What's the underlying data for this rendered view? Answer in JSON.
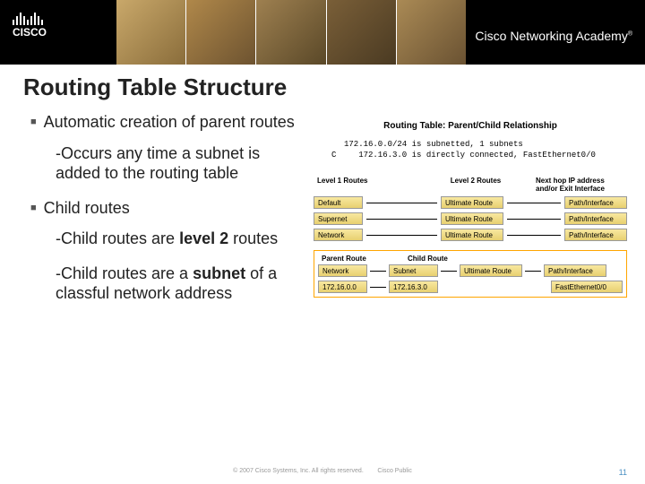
{
  "header": {
    "logo_text": "CISCO",
    "academy": "Cisco Networking Academy",
    "tm": "®"
  },
  "title": "Routing Table Structure",
  "bullets": {
    "b1": "Automatic creation of parent routes",
    "b1_sub": "-Occurs any time a subnet is added to the routing table",
    "b2": "Child routes",
    "b2_sub1_a": "-Child routes are ",
    "b2_sub1_b": "level 2",
    "b2_sub1_c": " routes",
    "b2_sub2_a": "-Child routes are a ",
    "b2_sub2_b": "subnet",
    "b2_sub2_c": " of a classful network address"
  },
  "diagram": {
    "title": "Routing Table: Parent/Child Relationship",
    "code": {
      "line1": "172.16.0.0/24 is subnetted, 1 subnets",
      "c_label": "C",
      "line2": "172.16.3.0 is directly connected, FastEthernet0/0"
    },
    "headers": {
      "h1": "Level 1 Routes",
      "h2": "Level 2 Routes",
      "h3": "Next hop IP address and/or Exit Interface"
    },
    "rows": {
      "default": "Default",
      "supernet": "Supernet",
      "network": "Network",
      "ultimate": "Ultimate Route",
      "pathif": "Path/Interface"
    },
    "parent_child": {
      "parent_label": "Parent Route",
      "child_label": "Child Route",
      "network": "Network",
      "subnet": "Subnet",
      "ip1": "172.16.0.0",
      "ip2": "172.16.3.0",
      "interface": "FastEthernet0/0"
    }
  },
  "footer": {
    "copyright": "© 2007 Cisco Systems, Inc. All rights reserved.",
    "classification": "Cisco Public",
    "page": "11"
  }
}
